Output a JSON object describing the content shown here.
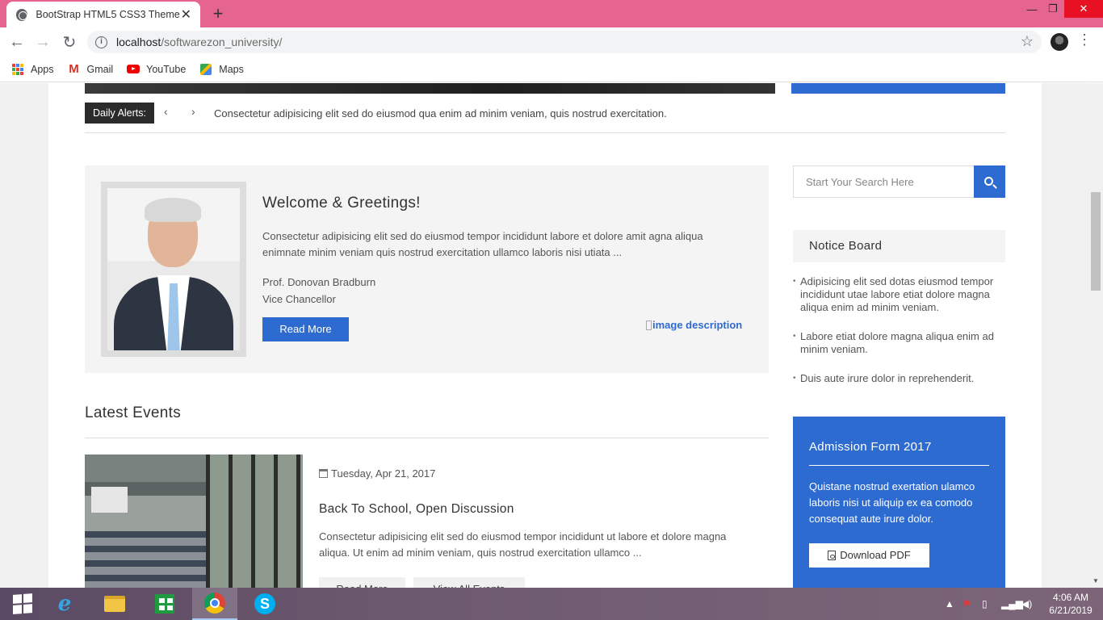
{
  "browser": {
    "tab_title": "BootStrap HTML5 CSS3 Theme",
    "tab_close": "✕",
    "new_tab": "+",
    "url_host": "localhost",
    "url_path": "/softwarezon_university/",
    "window_controls": {
      "minimize": "—",
      "maximize": "❐",
      "close": "✕"
    },
    "bookmarks": [
      {
        "label": "Apps",
        "icon": "apps-grid-icon"
      },
      {
        "label": "Gmail",
        "icon": "gmail-icon"
      },
      {
        "label": "YouTube",
        "icon": "youtube-icon"
      },
      {
        "label": "Maps",
        "icon": "maps-icon"
      }
    ]
  },
  "alerts": {
    "label": "Daily Alerts:",
    "prev": "‹",
    "next": "›",
    "text": "Consectetur adipisicing elit sed do eiusmod qua enim ad minim veniam, quis nostrud exercitation."
  },
  "welcome": {
    "title": "Welcome & Greetings!",
    "text": "Consectetur adipisicing elit sed do eiusmod tempor incididunt labore et dolore amit agna aliqua enimnate minim veniam quis nostrud exercitation ullamco laboris nisi utiata ...",
    "name": "Prof. Donovan Bradburn",
    "role": "Vice Chancellor",
    "button": "Read More",
    "image_alt": "image description"
  },
  "events": {
    "heading": "Latest Events",
    "items": [
      {
        "date": "Tuesday, Apr 21, 2017",
        "title": "Back To School, Open Discussion",
        "text": "Consectetur adipisicing elit sed do eiusmod tempor incididunt ut labore et dolore magna aliqua. Ut enim ad minim veniam, quis nostrud exercitation ullamco ...",
        "read_more": "Read More",
        "view_all": "View All Events"
      }
    ]
  },
  "sidebar": {
    "search_placeholder": "Start Your Search Here",
    "notice_title": "Notice Board",
    "notices": [
      "Adipisicing elit sed dotas eiusmod tempor incididunt utae labore etiat dolore magna aliqua enim ad minim veniam.",
      "Labore etiat dolore magna aliqua enim ad minim veniam.",
      "Duis aute irure dolor in reprehenderit."
    ],
    "admission": {
      "title": "Admission Form 2017",
      "text": "Quistane nostrud exertation ulamco laboris nisi ut aliquip ex ea comodo consequat aute irure dolor.",
      "button": "Download PDF"
    }
  },
  "taskbar": {
    "time": "4:06 AM",
    "date": "6/21/2019"
  },
  "colors": {
    "tab_strip": "#e56590",
    "accent_blue": "#2e6bd1",
    "alert_label_bg": "#2b2b2b"
  }
}
